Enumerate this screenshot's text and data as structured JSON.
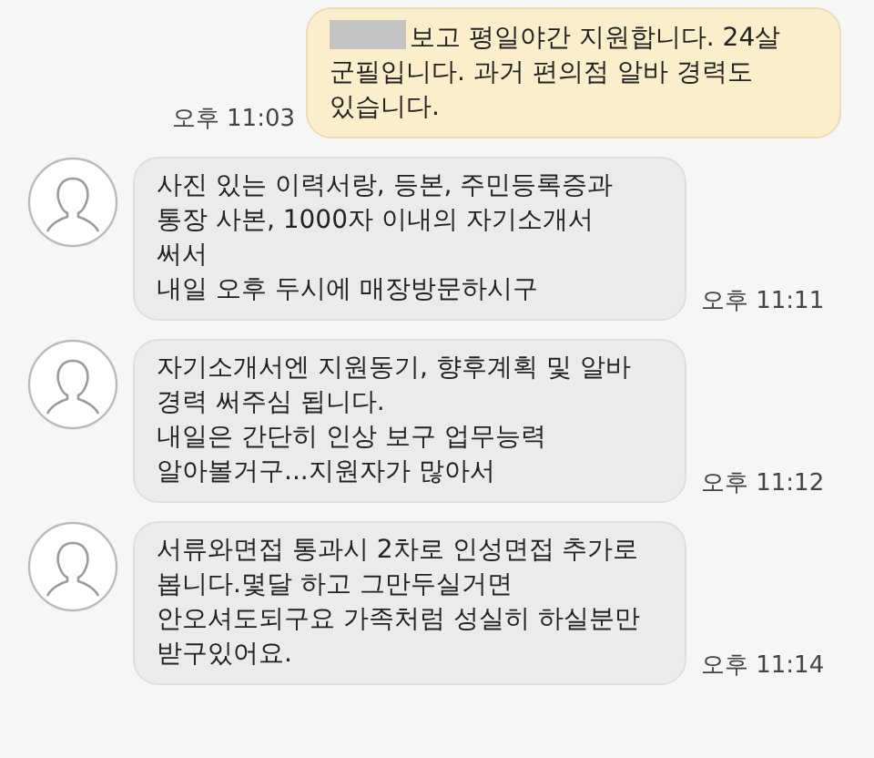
{
  "messages": [
    {
      "kind": "sent",
      "redacted_prefix": true,
      "text": "보고 평일야간 지원합니다. 24살\n군필입니다. 과거 편의점 알바 경력도\n있습니다.",
      "time": "오후 11:03"
    },
    {
      "kind": "received",
      "text": "사진 있는 이력서랑, 등본, 주민등록증과\n통장 사본, 1000자 이내의 자기소개서\n써서\n내일 오후 두시에 매장방문하시구",
      "time": "오후 11:11"
    },
    {
      "kind": "received",
      "text": "자기소개서엔 지원동기, 향후계획 및 알바\n경력 써주심 됩니다.\n내일은 간단히 인상 보구 업무능력\n알아볼거구...지원자가 많아서",
      "time": "오후 11:12"
    },
    {
      "kind": "received",
      "text": "서류와면접 통과시 2차로 인성면접 추가로\n봅니다.몇달 하고 그만두실거면\n안오셔도되구요 가족처럼 성실히 하실분만\n받구있어요.",
      "time": "오후 11:14"
    }
  ]
}
